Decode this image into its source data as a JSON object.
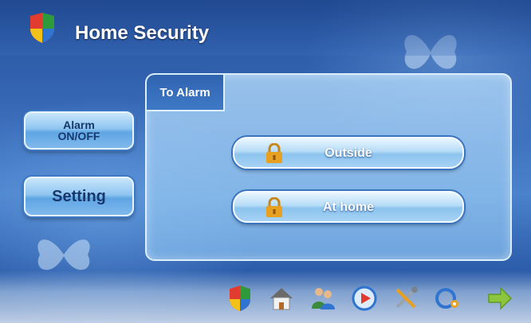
{
  "header": {
    "title": "Home Security",
    "logo_icon": "shield-logo-icon"
  },
  "sidebar": {
    "alarm_button": {
      "line1": "Alarm",
      "line2": "ON/OFF"
    },
    "setting_button": {
      "label": "Setting"
    }
  },
  "panel": {
    "tab_label": "To Alarm",
    "modes": [
      {
        "label": "Outside",
        "icon": "padlock-icon"
      },
      {
        "label": "At home",
        "icon": "padlock-icon"
      }
    ]
  },
  "taskbar": {
    "icons": [
      "shield-icon",
      "home-icon",
      "people-icon",
      "media-play-icon",
      "tools-icon",
      "network-icon",
      "arrow-right-icon"
    ]
  },
  "colors": {
    "background": "#3566b4",
    "panel": "#aad2f5",
    "tab": "#2f63b0",
    "button_text": "#17386c",
    "lock": "#e8a020"
  }
}
